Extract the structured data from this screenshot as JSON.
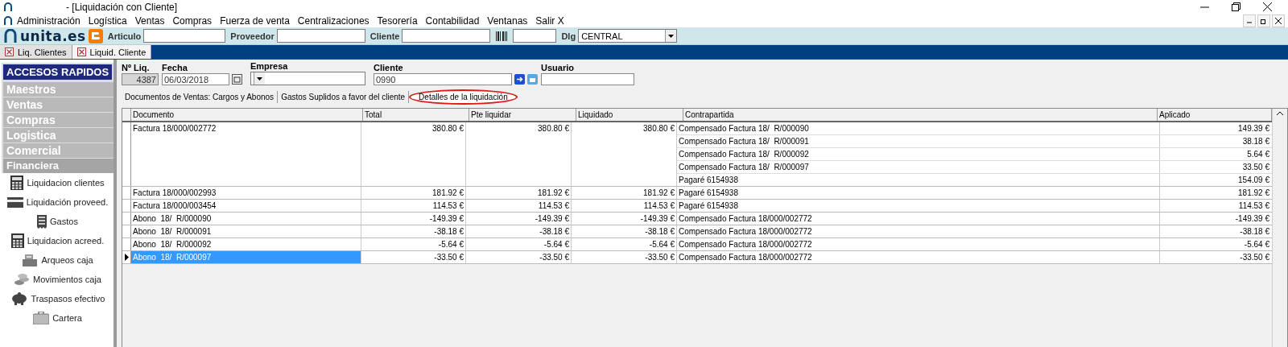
{
  "window": {
    "title": "- [Liquidación con Cliente]"
  },
  "menu": [
    "Administración",
    "Logística",
    "Ventas",
    "Compras",
    "Fuerza de venta",
    "Centralizaciones",
    "Tesorería",
    "Contabilidad",
    "Ventanas",
    "Salir X"
  ],
  "toolbar": {
    "logo": "unita.es",
    "fields": [
      {
        "label": "Articulo"
      },
      {
        "label": "Proveedor"
      },
      {
        "label": "Cliente"
      }
    ],
    "dlg_label": "Dlg",
    "dlg_value": "CENTRAL"
  },
  "doc_tabs": [
    {
      "label": "Liq. Clientes",
      "selected": false
    },
    {
      "label": "Liquid. Cliente",
      "selected": true
    }
  ],
  "sidebar": {
    "title": "ACCESOS RAPIDOS",
    "sections": [
      {
        "label": "Maestros",
        "expanded": false
      },
      {
        "label": "Ventas",
        "expanded": false
      },
      {
        "label": "Compras",
        "expanded": false
      },
      {
        "label": "Logistica",
        "expanded": false
      },
      {
        "label": "Comercial",
        "expanded": false
      },
      {
        "label": "Financiera",
        "expanded": true,
        "items": [
          {
            "label": "Liquidacion clientes",
            "kind": "calculator"
          },
          {
            "label": "Liquidación proveed.",
            "kind": "card"
          },
          {
            "label": "Gastos",
            "kind": "receipt"
          },
          {
            "label": "Liquidacion acreed.",
            "kind": "calculator"
          },
          {
            "label": "Arqueos caja",
            "kind": "register"
          },
          {
            "label": "Movimientos caja",
            "kind": "coins"
          },
          {
            "label": "Traspasos efectivo",
            "kind": "piggy"
          },
          {
            "label": "Cartera",
            "kind": "briefcase"
          }
        ]
      }
    ]
  },
  "header": {
    "liq_label": "Nº Liq.",
    "liq_value": "4387",
    "fecha_label": "Fecha",
    "fecha_value": "06/03/2018",
    "empresa_label": "Empresa",
    "cliente_label": "Cliente",
    "cliente_value": "0990",
    "usuario_label": "Usuario"
  },
  "sub_tabs": [
    {
      "label": "Documentos de Ventas: Cargos y Abonos",
      "selected": false,
      "circled": false
    },
    {
      "label": "Gastos Suplidos a favor del cliente",
      "selected": false,
      "circled": false
    },
    {
      "label": "Detalles de la liquidación",
      "selected": true,
      "circled": true
    }
  ],
  "table": {
    "columns": [
      "Documento",
      "Total",
      "Pte liquidar",
      "Liquidado",
      "Contrapartida",
      "Aplicado"
    ],
    "rows": [
      {
        "documento": "Factura 18/000/002772",
        "total": "380.80 €",
        "pte": "380.80 €",
        "liquidado": "380.80 €",
        "selected": false,
        "contrapartidas": [
          {
            "text": "Compensado Factura 18/  R/000090",
            "aplicado": "149.39 €"
          },
          {
            "text": "Compensado Factura 18/  R/000091",
            "aplicado": "38.18 €"
          },
          {
            "text": "Compensado Factura 18/  R/000092",
            "aplicado": "5.64 €"
          },
          {
            "text": "Compensado Factura 18/  R/000097",
            "aplicado": "33.50 €"
          },
          {
            "text": "Pagaré 6154938",
            "aplicado": "154.09 €"
          }
        ]
      },
      {
        "documento": "Factura 18/000/002993",
        "total": "181.92 €",
        "pte": "181.92 €",
        "liquidado": "181.92 €",
        "selected": false,
        "contrapartidas": [
          {
            "text": "Pagaré 6154938",
            "aplicado": "181.92 €"
          }
        ]
      },
      {
        "documento": "Factura 18/000/003454",
        "total": "114.53 €",
        "pte": "114.53 €",
        "liquidado": "114.53 €",
        "selected": false,
        "contrapartidas": [
          {
            "text": "Pagaré 6154938",
            "aplicado": "114.53 €"
          }
        ]
      },
      {
        "documento": "Abono  18/  R/000090",
        "total": "-149.39 €",
        "pte": "-149.39 €",
        "liquidado": "-149.39 €",
        "selected": false,
        "contrapartidas": [
          {
            "text": "Compensado Factura 18/000/002772",
            "aplicado": "-149.39 €"
          }
        ]
      },
      {
        "documento": "Abono  18/  R/000091",
        "total": "-38.18 €",
        "pte": "-38.18 €",
        "liquidado": "-38.18 €",
        "selected": false,
        "contrapartidas": [
          {
            "text": "Compensado Factura 18/000/002772",
            "aplicado": "-38.18 €"
          }
        ]
      },
      {
        "documento": "Abono  18/  R/000092",
        "total": "-5.64 €",
        "pte": "-5.64 €",
        "liquidado": "-5.64 €",
        "selected": false,
        "contrapartidas": [
          {
            "text": "Compensado Factura 18/000/002772",
            "aplicado": "-5.64 €"
          }
        ]
      },
      {
        "documento": "Abono  18/  R/000097",
        "total": "-33.50 €",
        "pte": "-33.50 €",
        "liquidado": "-33.50 €",
        "selected": true,
        "contrapartidas": [
          {
            "text": "Compensado Factura 18/000/002772",
            "aplicado": "-33.50 €"
          }
        ]
      }
    ]
  }
}
